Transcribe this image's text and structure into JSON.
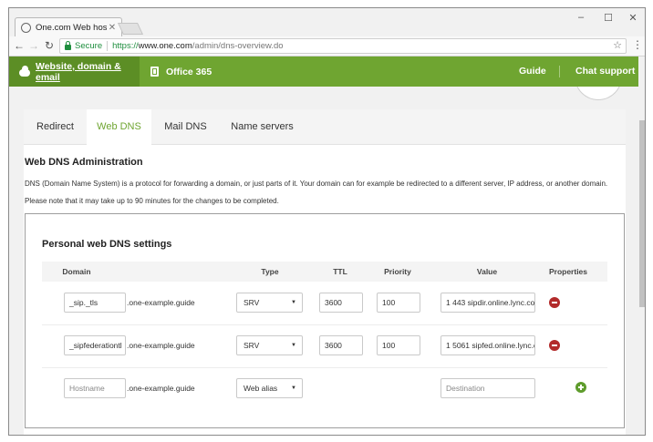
{
  "browser": {
    "tab_title": "One.com Web hosting",
    "secure_label": "Secure",
    "url_proto": "https://",
    "url_host": "www.one.com",
    "url_path": "/admin/dns-overview.do"
  },
  "topnav": {
    "website_label": "Website, domain & email",
    "office_label": "Office 365",
    "guide_label": "Guide",
    "chat_label": "Chat support"
  },
  "page_tabs": [
    "Redirect",
    "Web DNS",
    "Mail DNS",
    "Name servers"
  ],
  "heading": "Web DNS Administration",
  "description_1": "DNS (Domain Name System) is a protocol for forwarding a domain, or just parts of it. Your domain can for example be redirected to a different server, IP address, or another domain.",
  "description_2": "Please note that it may take up to 90 minutes for the changes to be completed.",
  "card": {
    "title": "Personal web DNS settings",
    "columns": [
      "Domain",
      "Type",
      "TTL",
      "Priority",
      "Value",
      "Properties"
    ],
    "rows": [
      {
        "domain": "_sip._tls",
        "suffix": ".one-example.guide",
        "type": "SRV",
        "ttl": "3600",
        "priority": "100",
        "value": "1 443 sipdir.online.lync.co"
      },
      {
        "domain": "_sipfederationtl",
        "suffix": ".one-example.guide",
        "type": "SRV",
        "ttl": "3600",
        "priority": "100",
        "value": "1 5061 sipfed.online.lync.c"
      }
    ],
    "new_row": {
      "hostname_placeholder": "Hostname",
      "suffix": ".one-example.guide",
      "type": "Web alias",
      "destination_placeholder": "Destination"
    }
  }
}
